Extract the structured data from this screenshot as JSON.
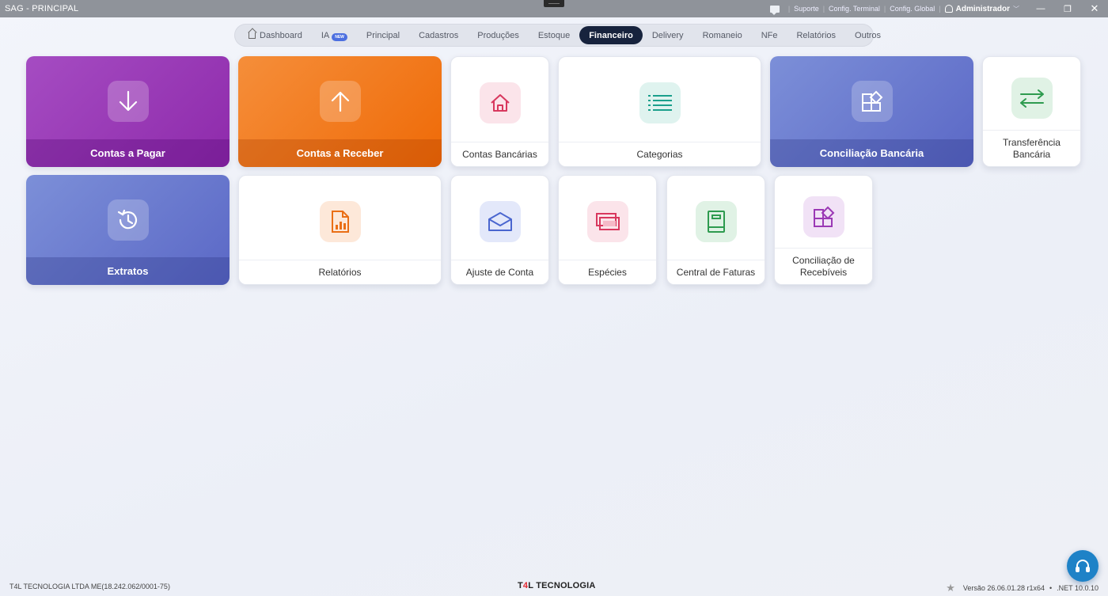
{
  "window": {
    "title": "SAG - PRINCIPAL",
    "support": "Suporte",
    "config_terminal": "Config. Terminal",
    "config_global": "Config. Global",
    "user": "Administrador",
    "minimize": "—",
    "restore": "❐"
  },
  "nav": {
    "items": [
      {
        "label": "Dashboard"
      },
      {
        "label": "IA",
        "badge": "NEW"
      },
      {
        "label": "Principal"
      },
      {
        "label": "Cadastros"
      },
      {
        "label": "Produções"
      },
      {
        "label": "Estoque"
      },
      {
        "label": "Financeiro",
        "active": true
      },
      {
        "label": "Delivery"
      },
      {
        "label": "Romaneio"
      },
      {
        "label": "NFe"
      },
      {
        "label": "Relatórios"
      },
      {
        "label": "Outros"
      }
    ]
  },
  "tiles": {
    "contas_pagar": {
      "label": "Contas a Pagar",
      "icon": "arrow-down-icon"
    },
    "contas_receber": {
      "label": "Contas a Receber",
      "icon": "arrow-up-icon"
    },
    "contas_bancarias": {
      "label": "Contas Bancárias",
      "icon": "home-icon",
      "color": "#d8385e"
    },
    "categorias": {
      "label": "Categorias",
      "icon": "list-icon",
      "color": "#1aa08c"
    },
    "conciliacao_bancaria": {
      "label": "Conciliação Bancária",
      "icon": "shapes-icon"
    },
    "transferencia_bancaria": {
      "label": "Transferência Bancária",
      "icon": "transfer-icon",
      "color": "#2e9b4f"
    },
    "extratos": {
      "label": "Extratos",
      "icon": "history-icon"
    },
    "relatorios": {
      "label": "Relatórios",
      "icon": "report-icon",
      "color": "#ea6f16"
    },
    "ajuste_conta": {
      "label": "Ajuste de Conta",
      "icon": "envelope-open-icon",
      "color": "#4a66cf"
    },
    "especies": {
      "label": "Espécies",
      "icon": "cash-icon",
      "color": "#d8385e"
    },
    "central_faturas": {
      "label": "Central de Faturas",
      "icon": "book-icon",
      "color": "#2e9b4f"
    },
    "conciliacao_recebiveis": {
      "label": "Conciliação de Recebíveis",
      "icon": "shapes-icon",
      "color": "#9b39b5"
    }
  },
  "footer": {
    "company": "T4L TECNOLOGIA LTDA ME(18.242.062/0001-75)",
    "brand_prefix": "T",
    "brand_accent": "4",
    "brand_suffix": "L TECNOLOGIA",
    "version": "Versão 26.06.01.28 r1x64",
    "dot": "•",
    "runtime": ".NET 10.0.10"
  }
}
